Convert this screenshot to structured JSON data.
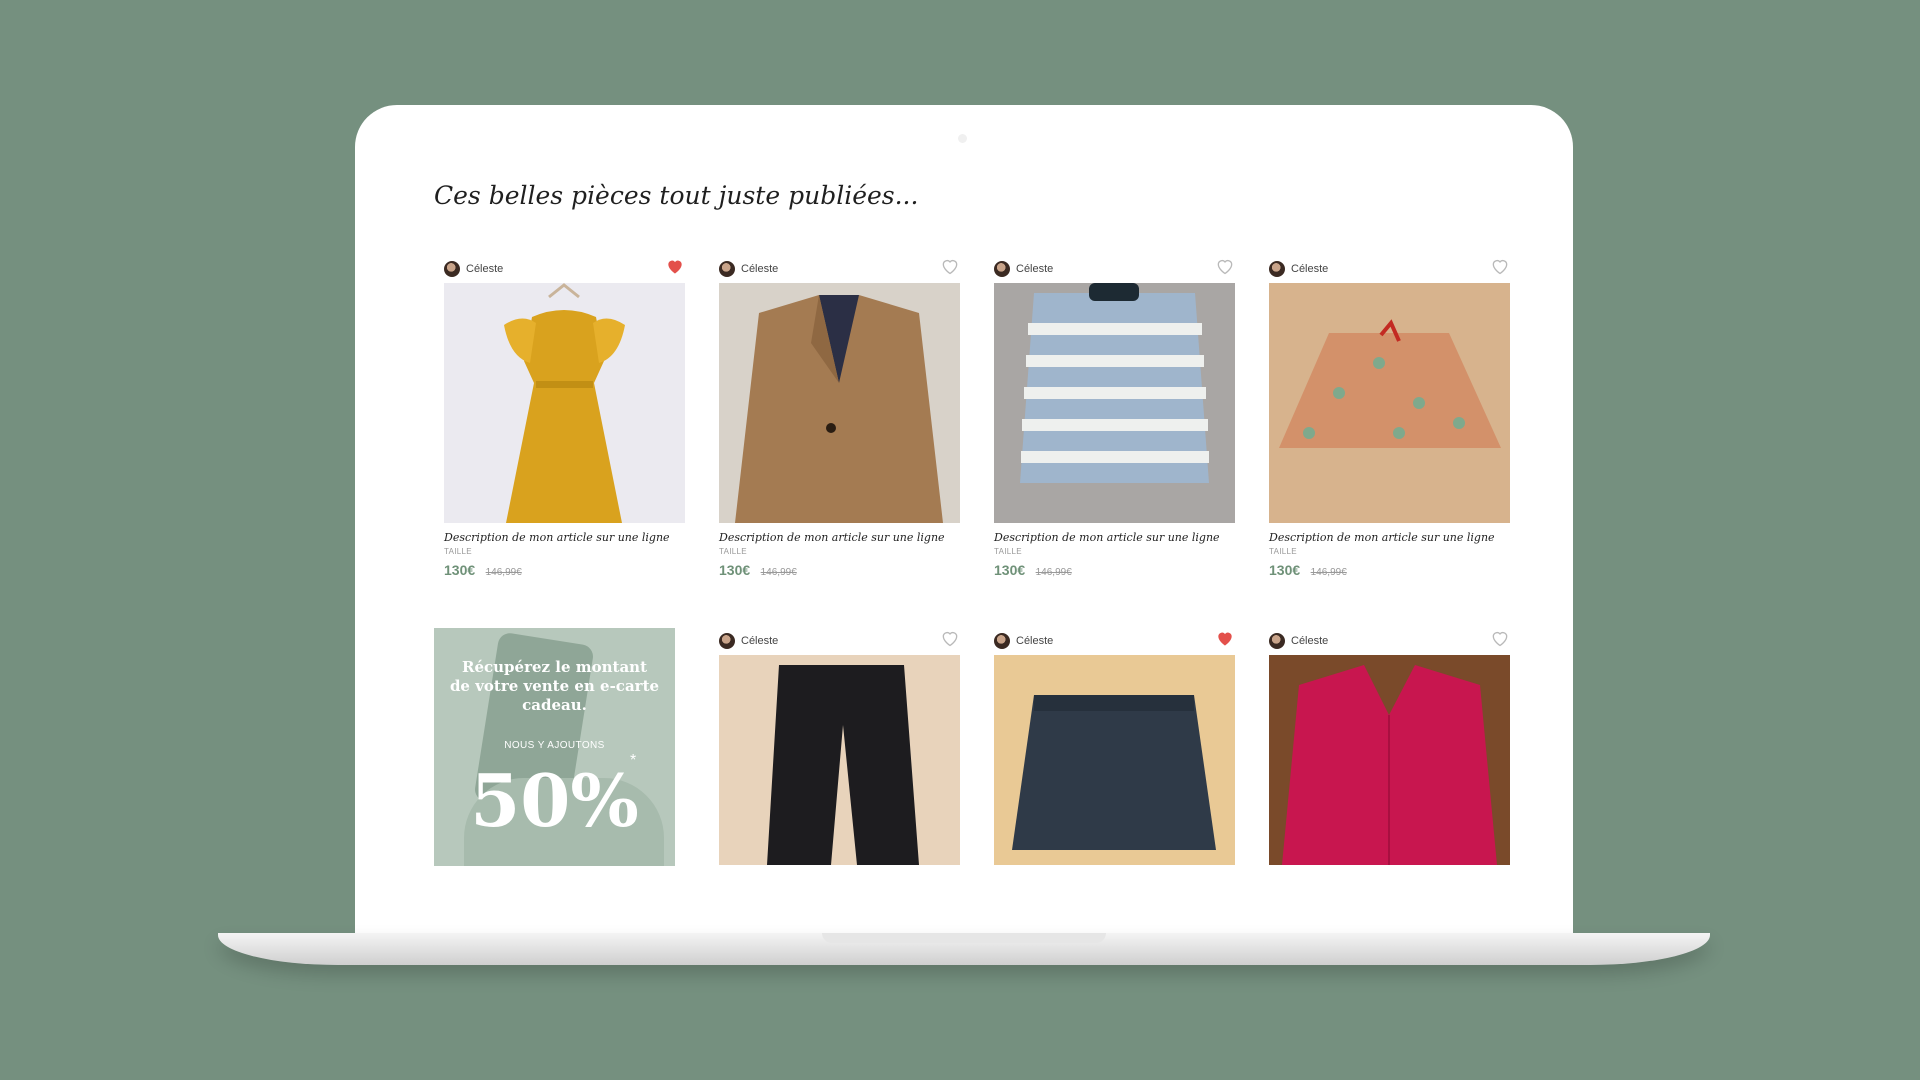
{
  "colors": {
    "background": "#75907f",
    "price": "#6f9178",
    "heart_active": "#e3504b",
    "heart_inactive": "#b9b9b9"
  },
  "page": {
    "title": "Ces belles pièces tout juste publiées..."
  },
  "products": [
    {
      "seller": "Céleste",
      "favorite": true,
      "item": "yellow ruffle dress",
      "description": "Description de mon article sur une ligne",
      "size_label": "TAILLE",
      "price": "130€",
      "old_price": "146,99€"
    },
    {
      "seller": "Céleste",
      "favorite": false,
      "item": "camel blazer",
      "description": "Description de mon article sur une ligne",
      "size_label": "TAILLE",
      "price": "130€",
      "old_price": "146,99€"
    },
    {
      "seller": "Céleste",
      "favorite": false,
      "item": "striped sweater",
      "description": "Description de mon article sur une ligne",
      "size_label": "TAILLE",
      "price": "130€",
      "old_price": "146,99€"
    },
    {
      "seller": "Céleste",
      "favorite": false,
      "item": "floral skirt",
      "description": "Description de mon article sur une ligne",
      "size_label": "TAILLE",
      "price": "130€",
      "old_price": "146,99€"
    },
    {
      "seller": "Céleste",
      "favorite": false,
      "item": "black trousers"
    },
    {
      "seller": "Céleste",
      "favorite": true,
      "item": "denim skirt"
    },
    {
      "seller": "Céleste",
      "favorite": false,
      "item": "pink cardigan"
    }
  ],
  "promo": {
    "line1": "Récupérez le montant",
    "line2": "de votre vente en e-carte",
    "line3": "cadeau.",
    "subline": "NOUS Y AJOUTONS",
    "percent": "50%",
    "asterisk": "*"
  }
}
